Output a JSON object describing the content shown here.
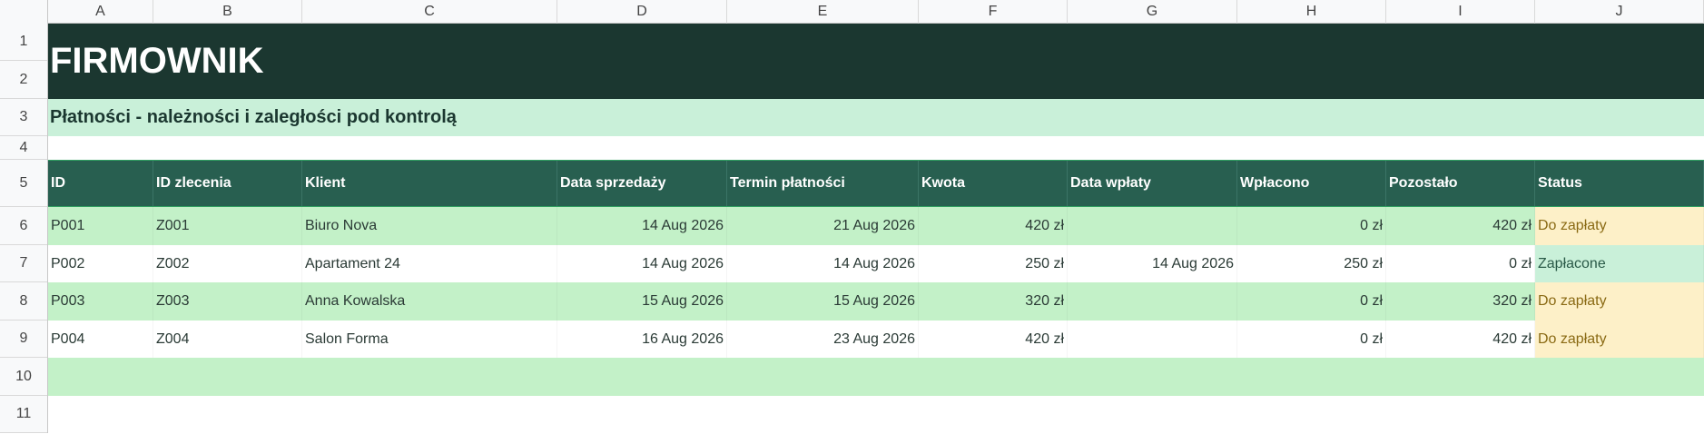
{
  "columns": [
    "A",
    "B",
    "C",
    "D",
    "E",
    "F",
    "G",
    "H",
    "I",
    "J"
  ],
  "rows": [
    "1",
    "2",
    "3",
    "4",
    "5",
    "6",
    "7",
    "8",
    "9",
    "10",
    "11"
  ],
  "title": "FIRMOWNIK",
  "subtitle": "Płatności - należności i zaległości pod kontrolą",
  "headers": [
    "ID",
    "ID zlecenia",
    "Klient",
    "Data sprzedaży",
    "Termin płatności",
    "Kwota",
    "Data wpłaty",
    "Wpłacono",
    "Pozostało",
    "Status"
  ],
  "records": [
    {
      "id": "P001",
      "order": "Z001",
      "client": "Biuro Nova",
      "sale_date": "14 Aug 2026",
      "due_date": "21 Aug 2026",
      "amount": "420 zł",
      "paid_date": "",
      "paid": "0 zł",
      "remaining": "420 zł",
      "status": "Do zapłaty"
    },
    {
      "id": "P002",
      "order": "Z002",
      "client": "Apartament 24",
      "sale_date": "14 Aug 2026",
      "due_date": "14 Aug 2026",
      "amount": "250 zł",
      "paid_date": "14 Aug 2026",
      "paid": "250 zł",
      "remaining": "0 zł",
      "status": "Zapłacone"
    },
    {
      "id": "P003",
      "order": "Z003",
      "client": "Anna Kowalska",
      "sale_date": "15 Aug 2026",
      "due_date": "15 Aug 2026",
      "amount": "320 zł",
      "paid_date": "",
      "paid": "0 zł",
      "remaining": "320 zł",
      "status": "Do zapłaty"
    },
    {
      "id": "P004",
      "order": "Z004",
      "client": "Salon Forma",
      "sale_date": "16 Aug 2026",
      "due_date": "23 Aug 2026",
      "amount": "420 zł",
      "paid_date": "",
      "paid": "0 zł",
      "remaining": "420 zł",
      "status": "Do zapłaty"
    }
  ],
  "colors": {
    "title_bg": "#1b3730",
    "subtitle_bg": "#c9f0d9",
    "header_bg": "#285f50",
    "row_green": "#c3f1c8",
    "status_due": "#fdf0c8",
    "status_paid": "#c9f0d9"
  }
}
